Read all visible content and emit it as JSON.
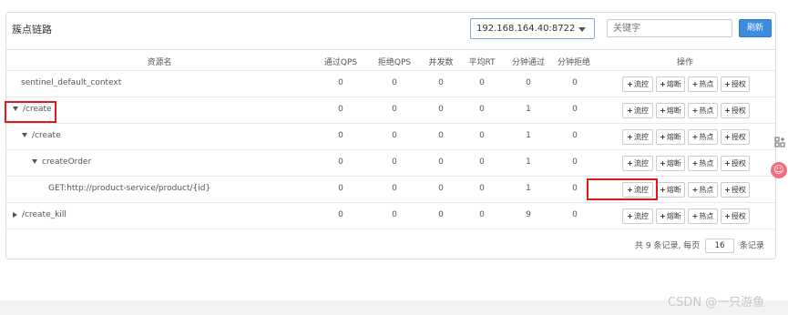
{
  "panel": {
    "title": "簇点链路",
    "ip_select": "192.168.164.40:8722",
    "search_placeholder": "关键字",
    "refresh_label": "刷新"
  },
  "table": {
    "headers": [
      "资源名",
      "通过QPS",
      "拒绝QPS",
      "并发数",
      "平均RT",
      "分钟通过",
      "分钟拒绝",
      "操作"
    ],
    "rows": [
      {
        "name": "sentinel_default_context",
        "values": [
          "0",
          "0",
          "0",
          "0",
          "0",
          "0"
        ]
      },
      {
        "name": "/create",
        "values": [
          "0",
          "0",
          "0",
          "0",
          "1",
          "0"
        ]
      },
      {
        "name": "/create",
        "values": [
          "0",
          "0",
          "0",
          "0",
          "1",
          "0"
        ]
      },
      {
        "name": "createOrder",
        "values": [
          "0",
          "0",
          "0",
          "0",
          "1",
          "0"
        ]
      },
      {
        "name": "GET:http://product-service/product/{id}",
        "values": [
          "0",
          "0",
          "0",
          "0",
          "1",
          "0"
        ]
      },
      {
        "name": "/create_kill",
        "values": [
          "0",
          "0",
          "0",
          "0",
          "9",
          "0"
        ]
      }
    ],
    "actions": [
      "流控",
      "熔断",
      "热点",
      "授权"
    ]
  },
  "footer": {
    "prefix": "共 9 条记录, 每页",
    "page_size": "16",
    "suffix": "条记录"
  },
  "watermark": "CSDN @一只游鱼",
  "colors": {
    "accent": "#3c8de1",
    "highlight": "#e4161d"
  }
}
